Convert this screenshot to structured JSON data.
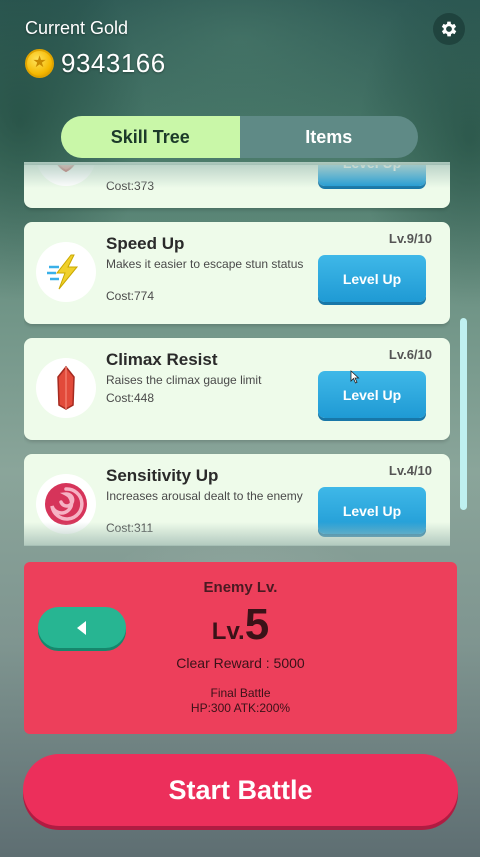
{
  "header": {
    "gold_label": "Current Gold",
    "gold_value": "9343166",
    "coin_icon": "coin-icon",
    "settings_icon": "gear-icon"
  },
  "tabs": [
    {
      "label": "Skill Tree",
      "active": true
    },
    {
      "label": "Items",
      "active": false
    }
  ],
  "skills": [
    {
      "name": "",
      "description": "",
      "cost": "Cost:373",
      "level": "",
      "button": "Level Up",
      "icon": "shield-icon"
    },
    {
      "name": "Speed Up",
      "description": "Makes it easier to escape stun status",
      "cost": "Cost:774",
      "level": "Lv.9/10",
      "button": "Level Up",
      "icon": "lightning-icon"
    },
    {
      "name": "Climax Resist",
      "description": "Raises the climax gauge limit",
      "cost": "Cost:448",
      "level": "Lv.6/10",
      "button": "Level Up",
      "icon": "crystal-icon"
    },
    {
      "name": "Sensitivity Up",
      "description": "Increases arousal dealt to the enemy",
      "cost": "Cost:311",
      "level": "Lv.4/10",
      "button": "Level Up",
      "icon": "swirl-icon"
    }
  ],
  "enemy": {
    "title": "Enemy Lv.",
    "lv_prefix": "Lv.",
    "lv_value": "5",
    "reward": "Clear Reward : 5000",
    "battle_name": "Final Battle",
    "stats": "HP:300 ATK:200%"
  },
  "start_button": "Start Battle",
  "colors": {
    "tab_active": "#c9f7a8",
    "level_button": "#1f9ad4",
    "enemy_panel": "#ed3f5b",
    "back_button": "#27b592",
    "start_button": "#ec2f5b"
  }
}
